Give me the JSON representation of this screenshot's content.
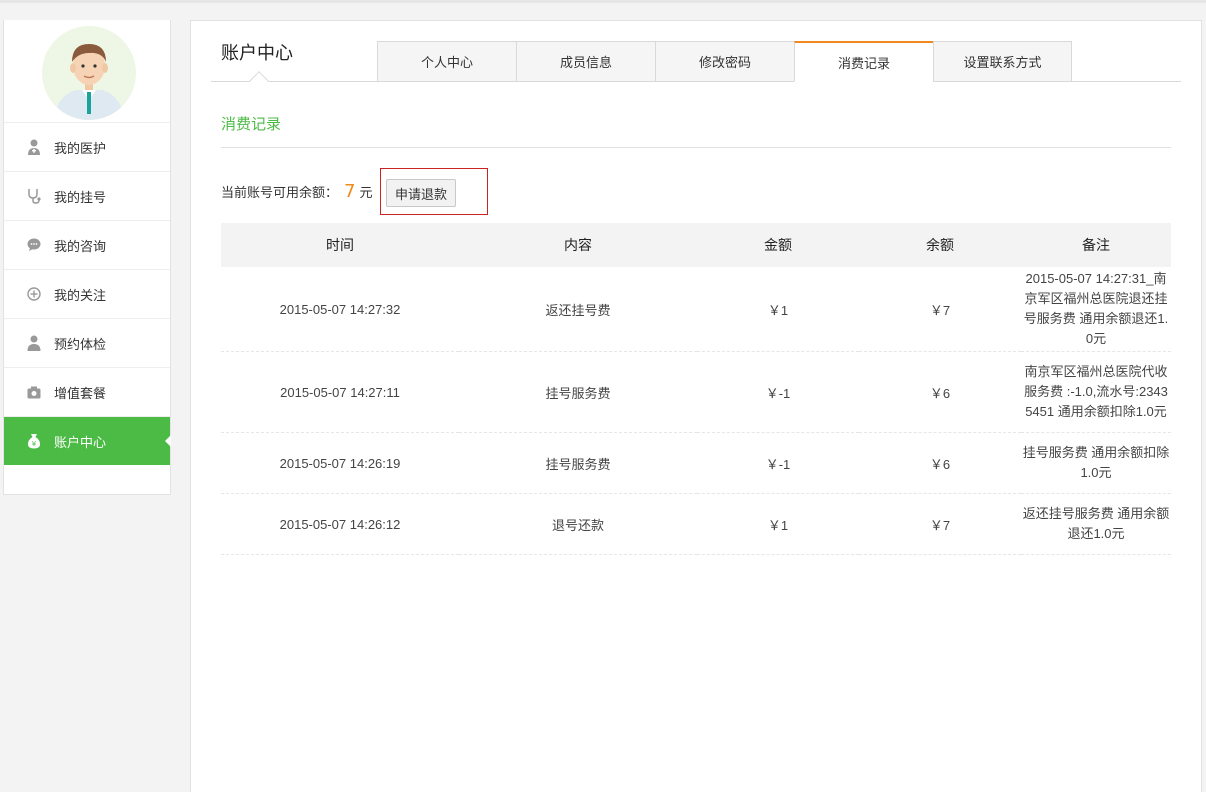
{
  "sidebar": {
    "items": [
      {
        "label": "我的医护",
        "icon": "nurse-icon"
      },
      {
        "label": "我的挂号",
        "icon": "stethoscope-icon"
      },
      {
        "label": "我的咨询",
        "icon": "chat-bubble-icon"
      },
      {
        "label": "我的关注",
        "icon": "plus-circle-icon"
      },
      {
        "label": "预约体检",
        "icon": "person-icon"
      },
      {
        "label": "增值套餐",
        "icon": "camera-icon"
      },
      {
        "label": "账户中心",
        "icon": "money-bag-icon",
        "active": true
      }
    ]
  },
  "main": {
    "title": "账户中心",
    "tabs": [
      {
        "label": "个人中心"
      },
      {
        "label": "成员信息"
      },
      {
        "label": "修改密码"
      },
      {
        "label": "消费记录",
        "active": true
      },
      {
        "label": "设置联系方式"
      }
    ],
    "section_title": "消费记录",
    "balance_label": "当前账号可用余额：",
    "balance_value": "7",
    "balance_unit": "元",
    "refund_button": "申请退款"
  },
  "table": {
    "headers": [
      "时间",
      "内容",
      "金额",
      "余额",
      "备注"
    ],
    "rows": [
      {
        "time": "2015-05-07 14:27:32",
        "content": "返还挂号费",
        "amount": "￥1",
        "balance": "￥7",
        "note": "2015-05-07 14:27:31_南京军区福州总医院退还挂号服务费 通用余额退还1.0元"
      },
      {
        "time": "2015-05-07 14:27:11",
        "content": "挂号服务费",
        "amount": "￥-1",
        "balance": "￥6",
        "note": "南京军区福州总医院代收服务费 :-1.0,流水号:23435451 通用余额扣除1.0元"
      },
      {
        "time": "2015-05-07 14:26:19",
        "content": "挂号服务费",
        "amount": "￥-1",
        "balance": "￥6",
        "note": "挂号服务费 通用余额扣除1.0元"
      },
      {
        "time": "2015-05-07 14:26:12",
        "content": "退号还款",
        "amount": "￥1",
        "balance": "￥7",
        "note": "返还挂号服务费 通用余额退还1.0元"
      }
    ]
  },
  "colors": {
    "accent_green": "#4cbb45",
    "accent_orange": "#f08a1c",
    "highlight_red": "#cc2222"
  }
}
